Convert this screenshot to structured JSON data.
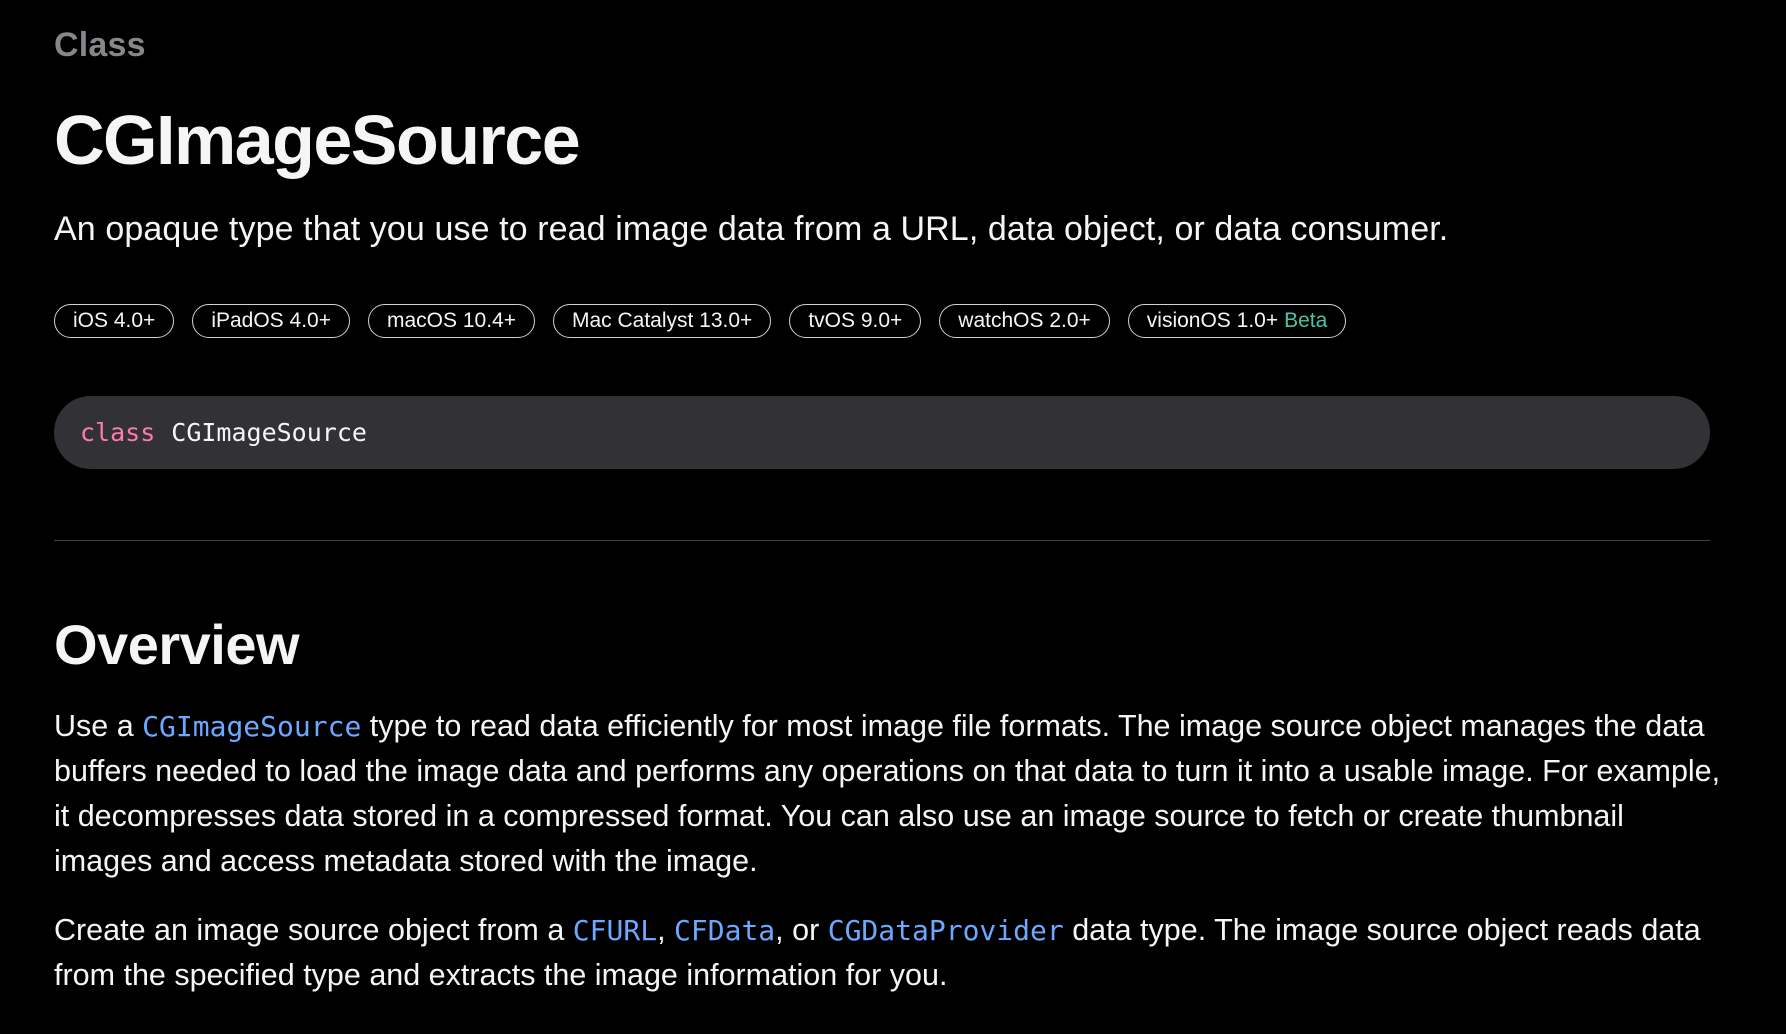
{
  "header": {
    "eyebrow": "Class",
    "title": "CGImageSource",
    "abstract": "An opaque type that you use to read image data from a URL, data object, or data consumer."
  },
  "availability": [
    {
      "label": "iOS 4.0+"
    },
    {
      "label": "iPadOS 4.0+"
    },
    {
      "label": "macOS 10.4+"
    },
    {
      "label": "Mac Catalyst 13.0+"
    },
    {
      "label": "tvOS 9.0+"
    },
    {
      "label": "watchOS 2.0+"
    },
    {
      "label": "visionOS 1.0+",
      "tag": "Beta"
    }
  ],
  "declaration": {
    "keyword": "class",
    "identifier": "CGImageSource"
  },
  "overview": {
    "title": "Overview",
    "p1": {
      "before": "Use a ",
      "link": "CGImageSource",
      "after": " type to read data efficiently for most image file formats. The image source object manages the data buffers needed to load the image data and performs any operations on that data to turn it into a usable image. For example, it decompresses data stored in a compressed format. You can also use an image source to fetch or create thumbnail images and access metadata stored with the image."
    },
    "p2": {
      "before": "Create an image source object from a ",
      "link1": "CFURL",
      "sep1": ", ",
      "link2": "CFData",
      "sep2": ", or ",
      "link3": "CGDataProvider",
      "after": " data type. The image source object reads data from the specified type and extracts the image information for you."
    }
  },
  "colors": {
    "background": "#000000",
    "text": "#f5f5f7",
    "eyebrow": "#86868b",
    "link": "#6ca8ff",
    "keyword": "#ff7ab2",
    "beta": "#4dc3a5",
    "code_bg": "#323236"
  }
}
